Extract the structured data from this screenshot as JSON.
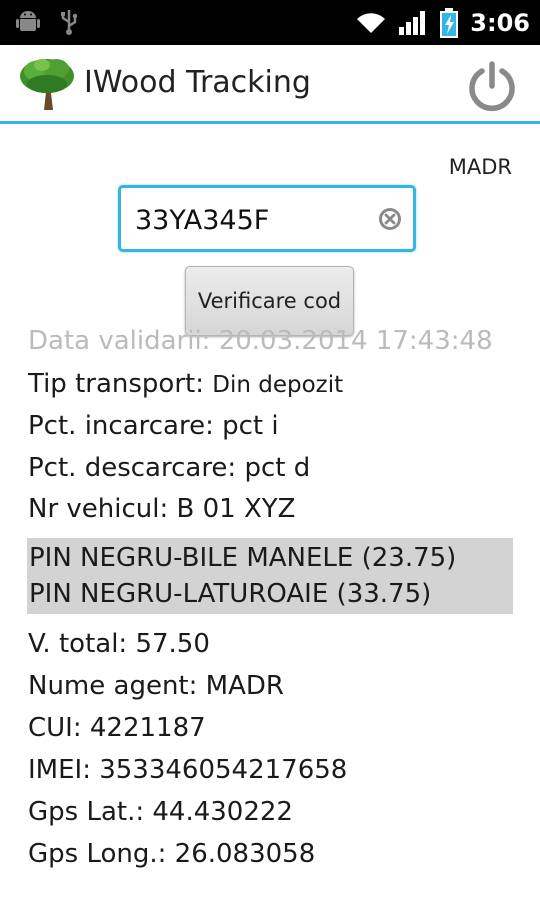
{
  "status_bar": {
    "time": "3:06",
    "left_icons": [
      "android-debug-icon",
      "usb-icon"
    ],
    "right_icons": [
      "wifi-icon",
      "signal-icon",
      "battery-charging-icon"
    ]
  },
  "action_bar": {
    "title": "IWood Tracking",
    "logo_icon": "tree-icon",
    "power_icon": "power-icon",
    "accent_color": "#33b5e5"
  },
  "user_label": "MADR",
  "code_input": {
    "value": "33YA345F"
  },
  "verify_button": {
    "label": "Verificare cod"
  },
  "details": {
    "clipped_line": "Data validarii: 20.03.2014 17:43:48",
    "tip_transport_label": "Tip transport:",
    "tip_transport_value": "Din depozit",
    "pct_incarcare": "Pct. incarcare: pct i",
    "pct_descarcare": "Pct. descarcare: pct d",
    "nr_vehicul": "Nr vehicul: B 01 XYZ",
    "products": [
      "PIN NEGRU-BILE MANELE (23.75)",
      "PIN NEGRU-LATUROAIE (33.75)"
    ],
    "v_total": "V. total: 57.50",
    "nume_agent": "Nume agent: MADR",
    "cui": "CUI: 4221187",
    "imei": "IMEI: 353346054217658",
    "gps_lat": "Gps Lat.: 44.430222",
    "gps_long": "Gps Long.: 26.083058"
  }
}
